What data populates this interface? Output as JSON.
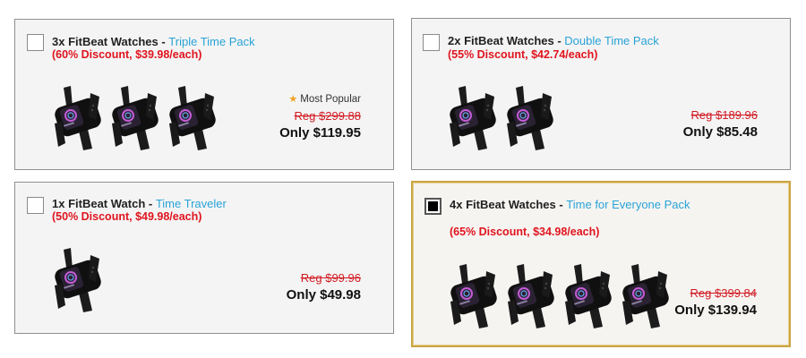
{
  "offers": [
    {
      "quantity_label": "3x FitBeat Watches",
      "separator": " - ",
      "pack_name": "Triple Time Pack",
      "discount": "(60% Discount, $39.98/each)",
      "badge": "Most Popular",
      "badge_icon": "star-icon",
      "regular_price": "Reg $299.88",
      "price": "Only $119.95",
      "watch_count": 3,
      "selected": false
    },
    {
      "quantity_label": "2x FitBeat Watches",
      "separator": " - ",
      "pack_name": "Double Time Pack",
      "discount": "(55% Discount, $42.74/each)",
      "regular_price": "Reg $189.96",
      "price": "Only $85.48",
      "watch_count": 2,
      "selected": false
    },
    {
      "quantity_label": "1x FitBeat Watch",
      "separator": " - ",
      "pack_name": "Time Traveler",
      "discount": "(50% Discount, $49.98/each)",
      "regular_price": "Reg $99.96",
      "price": "Only $49.98",
      "watch_count": 1,
      "selected": false
    },
    {
      "quantity_label": "4x FitBeat Watches",
      "separator": " - ",
      "pack_name": "Time for Everyone Pack",
      "discount": "(65% Discount, $34.98/each)",
      "regular_price": "Reg $399.84",
      "price": "Only $139.94",
      "watch_count": 4,
      "selected": true
    }
  ],
  "colors": {
    "pack_name": "#29a3d6",
    "discount": "#e0141e",
    "regular_price": "#d11a22",
    "selected_border": "#c9a544",
    "star": "#f0a020"
  }
}
